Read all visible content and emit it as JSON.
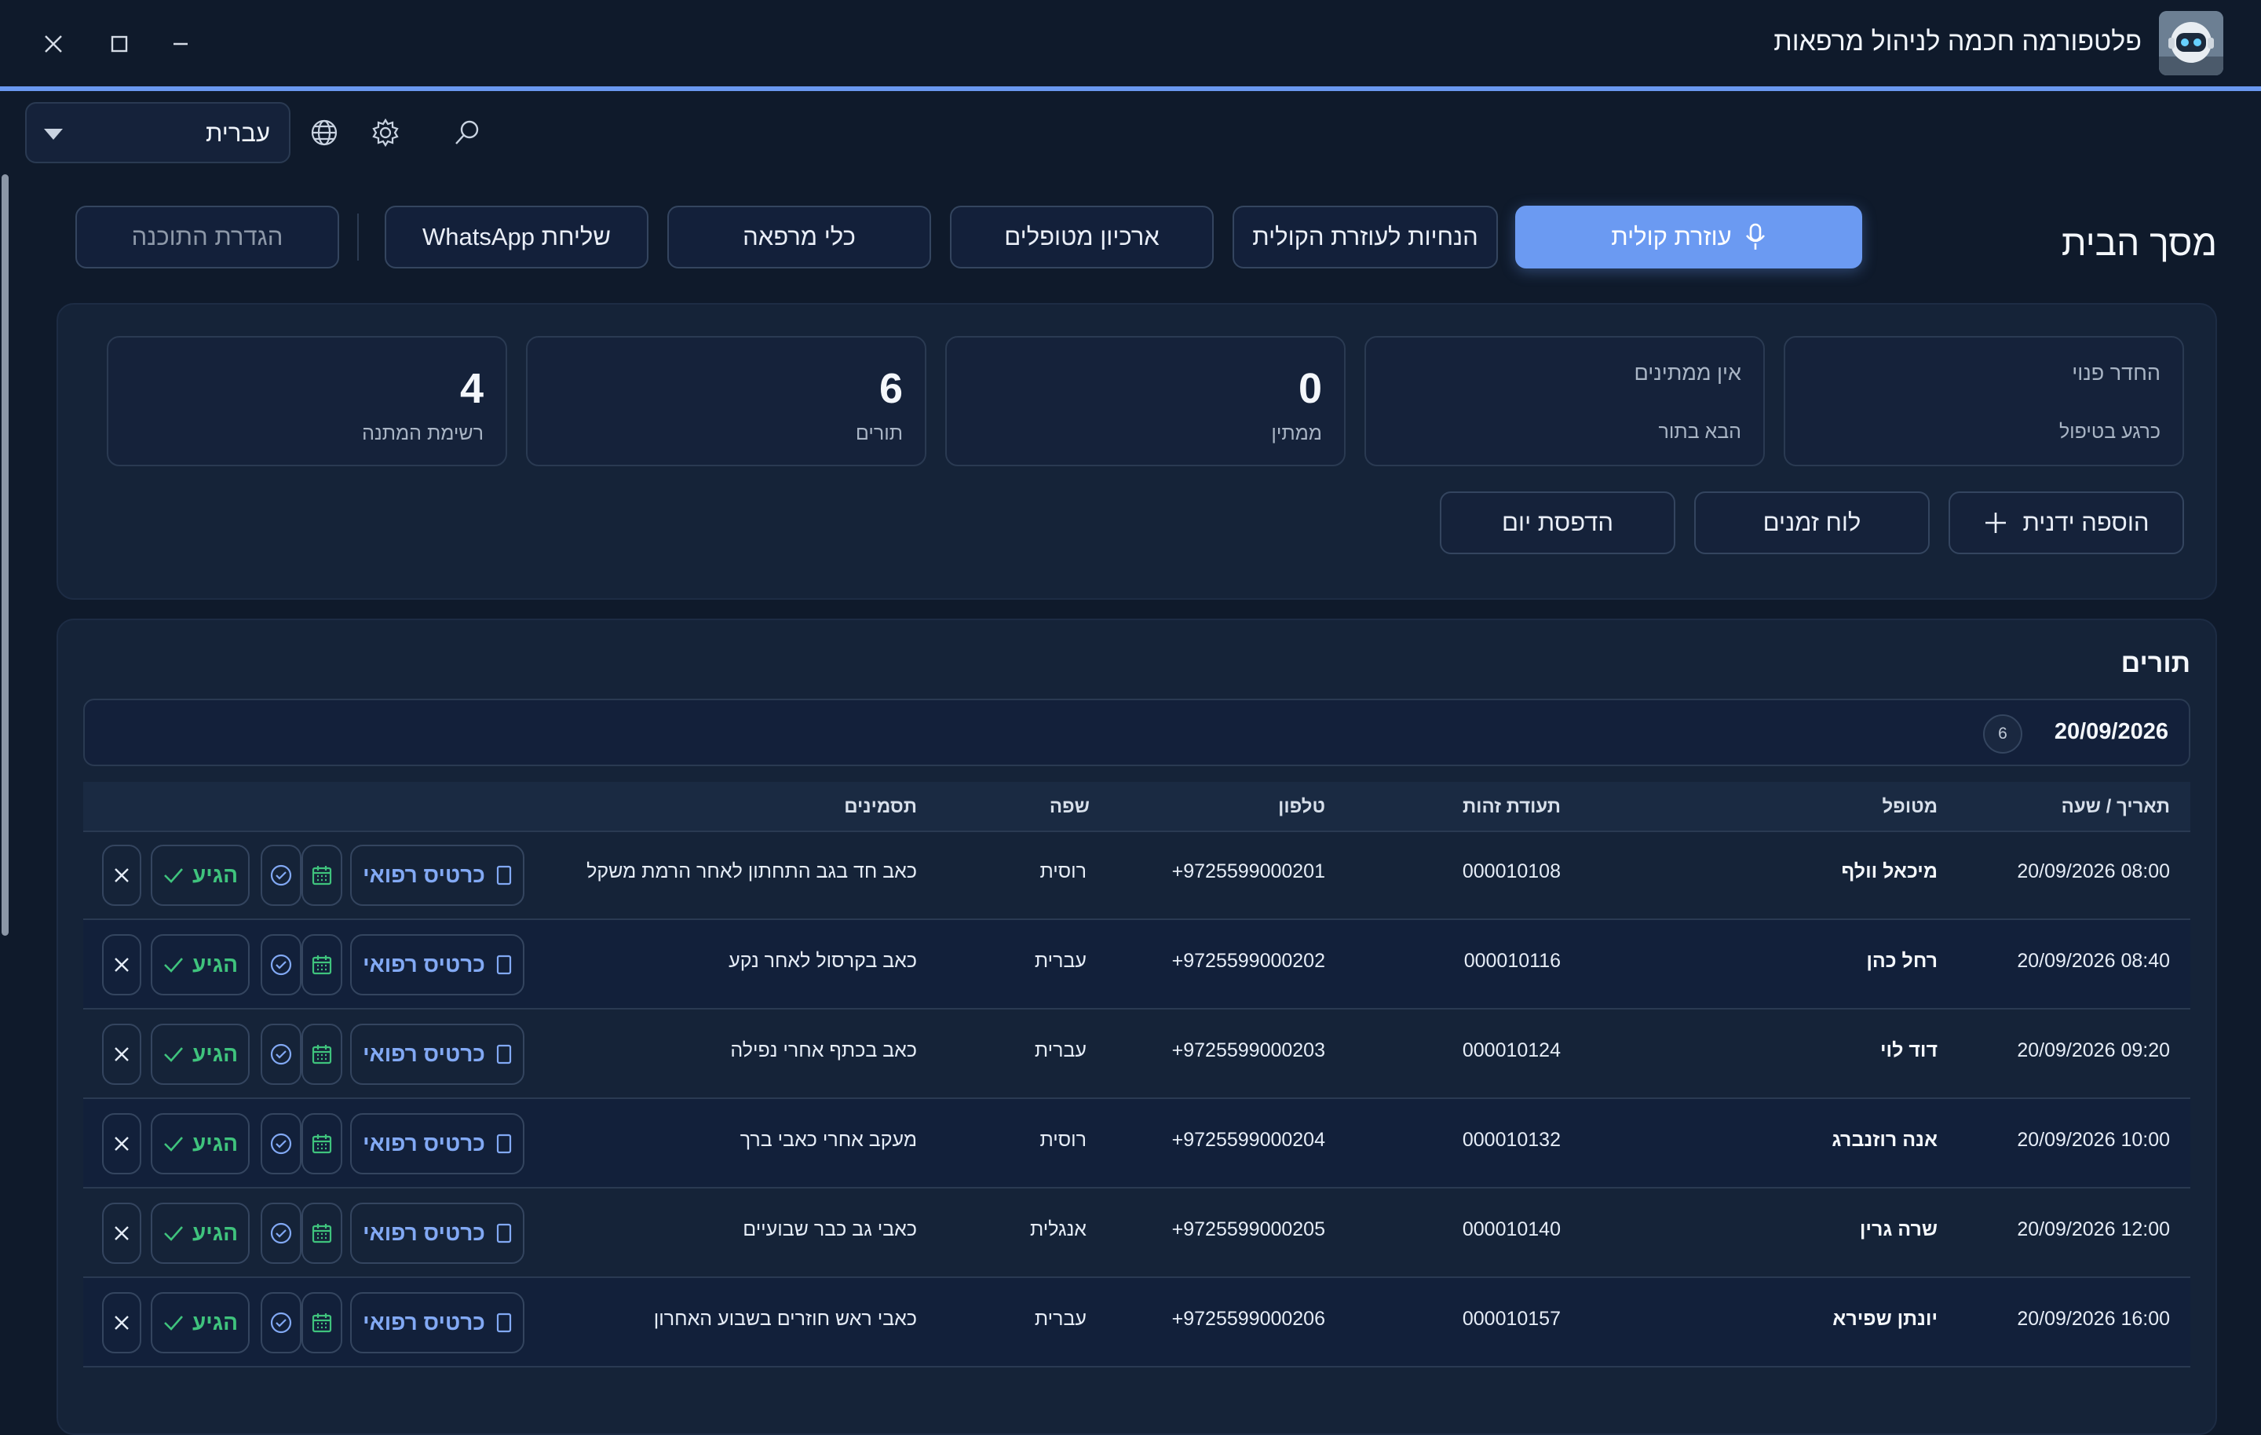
{
  "window": {
    "title": "פלטפורמה חכמה לניהול מרפאות",
    "controls": [
      "close-icon",
      "maximize-icon",
      "minimize-icon"
    ]
  },
  "toolbar": {
    "language_value": "עברית",
    "icons": [
      "globe-icon",
      "gear-icon",
      "search-icon"
    ]
  },
  "nav": {
    "home_title": "מסך הבית",
    "voice_assistant": "עוזרת קולית",
    "voice_instructions": "הנחיות לעוזרת הקולית",
    "patient_archive": "ארכיון מטופלים",
    "clinic_tools": "כלי מרפאה",
    "send_whatsapp": "שליחת WhatsApp",
    "program_settings": "הגדרת התוכנה"
  },
  "stats": {
    "room": {
      "line1": "החדר פנוי",
      "line2": "כרגע בטיפול"
    },
    "next": {
      "line1": "אין ממתינים",
      "line2": "הבא בתור"
    },
    "waiting": {
      "value": "0",
      "label": "ממתין"
    },
    "appointments": {
      "value": "6",
      "label": "תורים"
    },
    "waitlist": {
      "value": "4",
      "label": "רשימת המתנה"
    }
  },
  "actions": {
    "manual_add": "הוספה ידנית",
    "schedule": "לוח זמנים",
    "print_day": "הדפסת יום"
  },
  "appointments": {
    "title": "תורים",
    "date": "20/09/2026",
    "count": "6",
    "columns": {
      "datetime": "תאריך / שעה",
      "patient": "מטופל",
      "id": "תעודת זהות",
      "phone": "טלפון",
      "language": "שפה",
      "symptoms": "תסמינים"
    },
    "card_label": "כרטיס רפואי",
    "arrived_label": "הגיע",
    "rows": [
      {
        "datetime": "08:00 20/09/2026",
        "patient": "מיכאל וולף",
        "id": "000010108",
        "phone": "+9725599000201",
        "language": "רוסית",
        "symptoms": "כאב חד בגב התחתון לאחר הרמת משקל"
      },
      {
        "datetime": "08:40 20/09/2026",
        "patient": "רחל כהן",
        "id": "000010116",
        "phone": "+9725599000202",
        "language": "עברית",
        "symptoms": "כאב בקרסול לאחר נקע"
      },
      {
        "datetime": "09:20 20/09/2026",
        "patient": "דוד לוי",
        "id": "000010124",
        "phone": "+9725599000203",
        "language": "עברית",
        "symptoms": "כאב בכתף אחרי נפילה"
      },
      {
        "datetime": "10:00 20/09/2026",
        "patient": "אנה רוזנברג",
        "id": "000010132",
        "phone": "+9725599000204",
        "language": "רוסית",
        "symptoms": "מעקב אחרי כאבי ברך"
      },
      {
        "datetime": "12:00 20/09/2026",
        "patient": "שרה גרין",
        "id": "000010140",
        "phone": "+9725599000205",
        "language": "אנגלית",
        "symptoms": "כאבי גב כבר שבועיים"
      },
      {
        "datetime": "16:00 20/09/2026",
        "patient": "יונתן שפירא",
        "id": "000010157",
        "phone": "+9725599000206",
        "language": "עברית",
        "symptoms": "כאבי ראש חוזרים בשבוע האחרון"
      }
    ]
  },
  "colors": {
    "background": "#0f1a2b",
    "accent": "#6b9af2",
    "success": "#3fc37d"
  }
}
